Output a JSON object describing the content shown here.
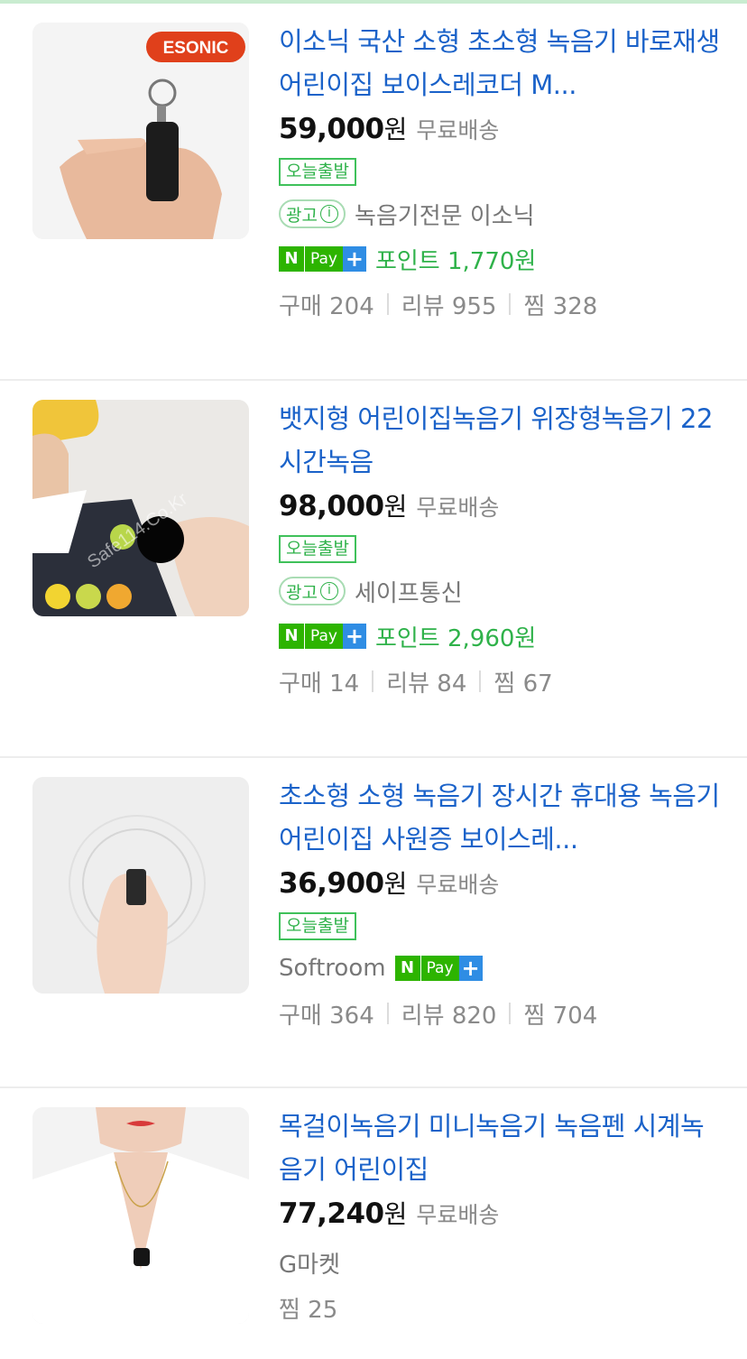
{
  "items": [
    {
      "title": "이소닉 국산 소형 초소형 녹음기 바로재생 어린이집 보이스레코더 M...",
      "price": "59,000",
      "won": "원",
      "shipping": "무료배송",
      "today_badge": "오늘출발",
      "ad_label": "광고",
      "seller": "녹음기전문 이소닉",
      "npay": "Pay",
      "point": "포인트 1,770원",
      "buy": "구매 204",
      "review": "리뷰 955",
      "zzim": "찜 328",
      "logo": "ESONIC"
    },
    {
      "title": "뱃지형 어린이집녹음기 위장형녹음기 22시간녹음",
      "price": "98,000",
      "won": "원",
      "shipping": "무료배송",
      "today_badge": "오늘출발",
      "ad_label": "광고",
      "seller": "세이프통신",
      "npay": "Pay",
      "point": "포인트 2,960원",
      "buy": "구매 14",
      "review": "리뷰 84",
      "zzim": "찜 67",
      "watermark": "Safe114.Co.Kr"
    },
    {
      "title": "초소형 소형 녹음기 장시간 휴대용 녹음기 어린이집 사원증 보이스레...",
      "price": "36,900",
      "won": "원",
      "shipping": "무료배송",
      "today_badge": "오늘출발",
      "seller": "Softroom",
      "npay": "Pay",
      "buy": "구매 364",
      "review": "리뷰 820",
      "zzim": "찜 704"
    },
    {
      "title": "목걸이녹음기 미니녹음기 녹음펜 시계녹음기 어린이집",
      "price": "77,240",
      "won": "원",
      "shipping": "무료배송",
      "seller": "G마켓",
      "zzim": "찜 25"
    }
  ],
  "colors": {
    "title": "#1a62c9",
    "green": "#2fb24a",
    "npay_green": "#2db400",
    "npay_blue": "#2f8de4"
  }
}
